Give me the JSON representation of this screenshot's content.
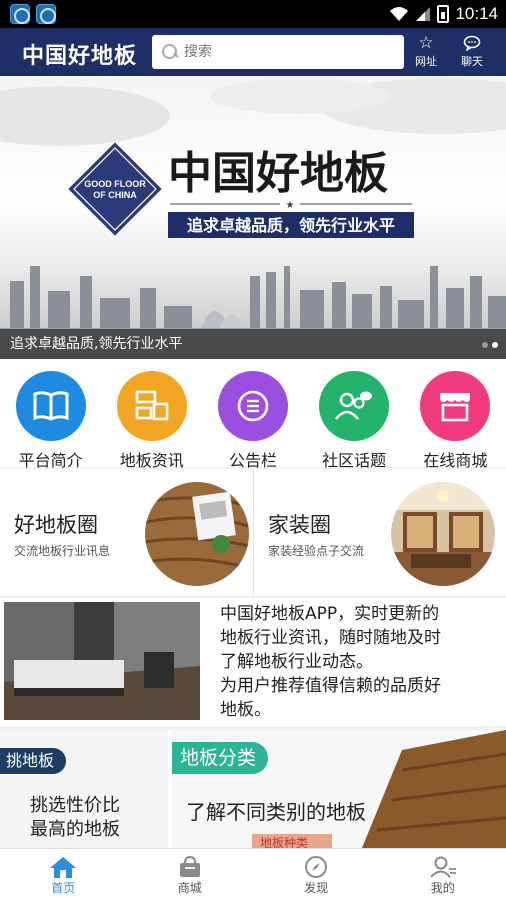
{
  "status_bar": {
    "time": "10:14"
  },
  "header": {
    "title": "中国好地板",
    "search_placeholder": "搜索",
    "favorite_label": "网址",
    "chat_label": "聊天"
  },
  "banner": {
    "logo_text": "GOOD FLOOR OF CHINA",
    "headline": "中国好地板",
    "slogan": "追求卓越品质，领先行业水平",
    "caption": "追求卓越品质,领先行业水平"
  },
  "categories": [
    {
      "label": "平台简介",
      "color": "#1f8be0",
      "icon": "book-icon"
    },
    {
      "label": "地板资讯",
      "color": "#f2a623",
      "icon": "news-icon"
    },
    {
      "label": "公告栏",
      "color": "#9b4fe0",
      "icon": "list-icon"
    },
    {
      "label": "社区话题",
      "color": "#23b36b",
      "icon": "community-icon"
    },
    {
      "label": "在线商城",
      "color": "#f03c7e",
      "icon": "store-icon"
    }
  ],
  "cards": [
    {
      "title": "好地板圈",
      "subtitle": "交流地板行业讯息"
    },
    {
      "title": "家装圈",
      "subtitle": "家装经验点子交流"
    }
  ],
  "promo": {
    "lines": [
      "中国好地板APP，实时更新的",
      "地板行业资讯，随时随地及时",
      "了解地板行业动态。",
      "为用户推荐值得信赖的品质好",
      "地板。"
    ]
  },
  "promo2": {
    "left_tag": "挑地板",
    "left_line1": "挑选性价比",
    "left_line2": "最高的地板",
    "right_tag": "地板分类",
    "right_text": "了解不同类别的地板",
    "right_sub": "地板种类"
  },
  "tabbar": [
    {
      "label": "首页",
      "active": true
    },
    {
      "label": "商城",
      "active": false
    },
    {
      "label": "发现",
      "active": false
    },
    {
      "label": "我的",
      "active": false
    }
  ]
}
